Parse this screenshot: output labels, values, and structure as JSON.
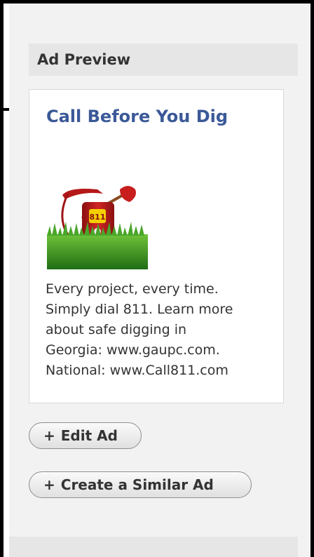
{
  "section": {
    "title": "Ad Preview"
  },
  "ad": {
    "title": "Call Before You Dig",
    "image_alt": "811 red telephone with shovel on grass",
    "image_badge": "811",
    "body_lines": [
      "Every project, every time.",
      "Simply dial 811. Learn more",
      "about safe digging in",
      "Georgia: www.gaupc.com.",
      "National: www.Call811.com"
    ]
  },
  "actions": {
    "edit_label": "Edit Ad",
    "similar_label": "Create a Similar Ad",
    "plus_symbol": "+"
  },
  "colors": {
    "link_blue": "#3b5998",
    "panel_bg": "#f2f2f2",
    "header_bg": "#e6e6e6"
  }
}
